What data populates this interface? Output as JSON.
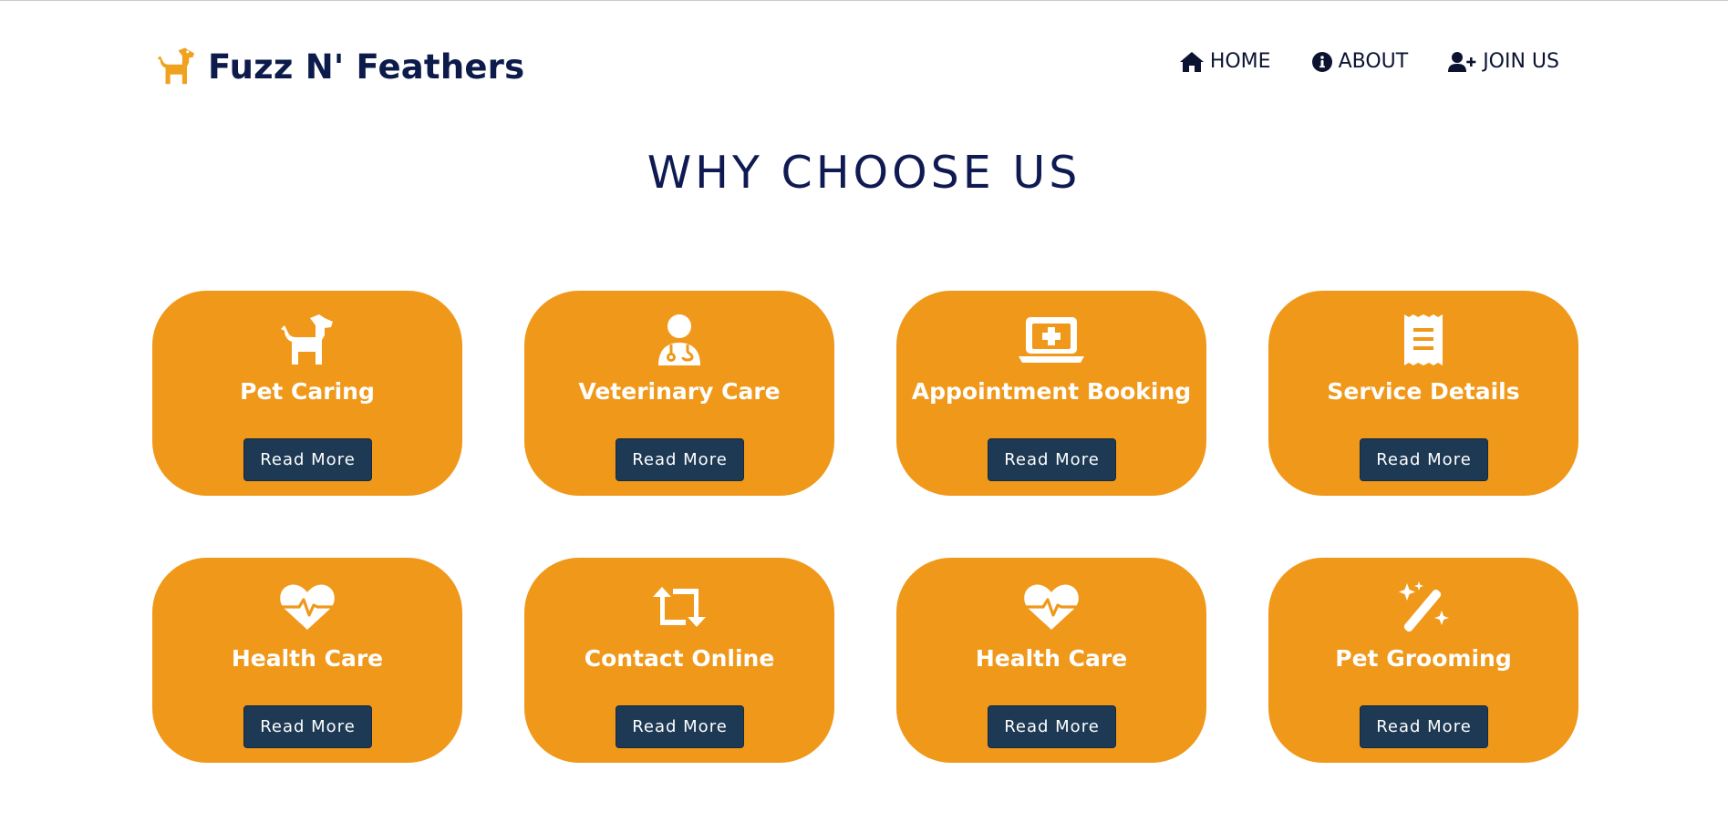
{
  "brand": {
    "name": "Fuzz N' Feathers",
    "logo_icon": "dog-icon",
    "color": "#0d1b4b",
    "accent": "#f0981a"
  },
  "nav": [
    {
      "label": "HOME",
      "icon": "home-icon"
    },
    {
      "label": "ABOUT",
      "icon": "info-icon"
    },
    {
      "label": "JOIN US",
      "icon": "user-plus-icon"
    }
  ],
  "section": {
    "title": "WHY CHOOSE US"
  },
  "cards": [
    {
      "title": "Pet Caring",
      "icon": "dog-icon",
      "button": "Read More"
    },
    {
      "title": "Veterinary Care",
      "icon": "doctor-icon",
      "button": "Read More"
    },
    {
      "title": "Appointment Booking",
      "icon": "laptop-medical-icon",
      "button": "Read More"
    },
    {
      "title": "Service Details",
      "icon": "receipt-icon",
      "button": "Read More"
    },
    {
      "title": "Health Care",
      "icon": "heart-pulse-icon",
      "button": "Read More"
    },
    {
      "title": "Contact Online",
      "icon": "retweet-icon",
      "button": "Read More"
    },
    {
      "title": "Health Care",
      "icon": "heart-pulse-icon",
      "button": "Read More"
    },
    {
      "title": "Pet Grooming",
      "icon": "magic-wand-icon",
      "button": "Read More"
    }
  ],
  "colors": {
    "card_background": "#f0981a",
    "button_background": "#1e3954",
    "heading": "#101a52"
  }
}
